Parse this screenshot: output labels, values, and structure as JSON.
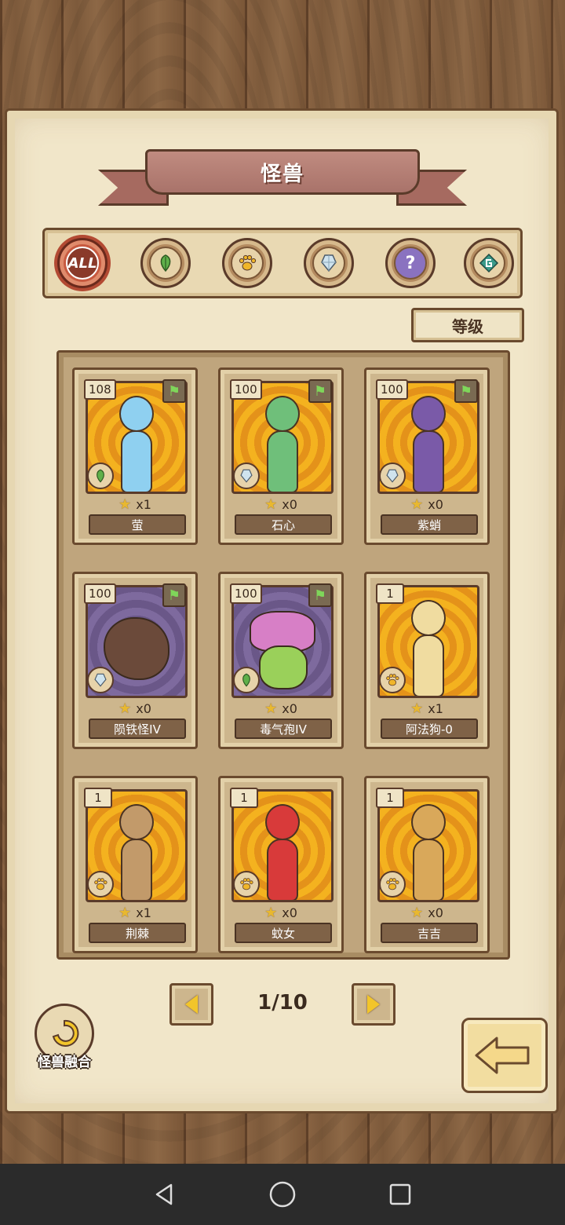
{
  "title": "怪兽",
  "filters": [
    {
      "name": "all",
      "label": "ALL",
      "icon": "all-icon",
      "active": true
    },
    {
      "name": "plant",
      "label": "",
      "icon": "leaf-icon",
      "active": false
    },
    {
      "name": "beast",
      "label": "",
      "icon": "paw-icon",
      "active": false
    },
    {
      "name": "crystal",
      "label": "",
      "icon": "crystal-icon",
      "active": false
    },
    {
      "name": "unknown",
      "label": "",
      "icon": "question-icon",
      "active": false
    },
    {
      "name": "special",
      "label": "",
      "icon": "g-rune-icon",
      "active": false
    }
  ],
  "sort_label": "等级",
  "cards": [
    {
      "level": "108",
      "count": "x1",
      "name": "萤",
      "type_icon": "leaf-icon",
      "flag": true,
      "bg": "gold",
      "color": "#8fd0f0"
    },
    {
      "level": "100",
      "count": "x0",
      "name": "石心",
      "type_icon": "crystal-icon",
      "flag": true,
      "bg": "gold",
      "color": "#6fbf7a"
    },
    {
      "level": "100",
      "count": "x0",
      "name": "紫蛸",
      "type_icon": "crystal-icon",
      "flag": true,
      "bg": "gold",
      "color": "#7a5aa8"
    },
    {
      "level": "100",
      "count": "x0",
      "name": "陨铁怪IV",
      "type_icon": "crystal-icon",
      "flag": true,
      "bg": "purple",
      "color": "#6b4a3a"
    },
    {
      "level": "100",
      "count": "x0",
      "name": "毒气孢IV",
      "type_icon": "leaf-icon",
      "flag": true,
      "bg": "purple",
      "color": "#d77fc6"
    },
    {
      "level": "1",
      "count": "x1",
      "name": "阿法狗-0",
      "type_icon": "paw-icon",
      "flag": false,
      "bg": "gold",
      "color": "#f0dca0"
    },
    {
      "level": "1",
      "count": "x1",
      "name": "荆棘",
      "type_icon": "paw-icon",
      "flag": false,
      "bg": "gold",
      "color": "#c29a6a"
    },
    {
      "level": "1",
      "count": "x0",
      "name": "蚊女",
      "type_icon": "paw-icon",
      "flag": false,
      "bg": "gold",
      "color": "#d83a3a"
    },
    {
      "level": "1",
      "count": "x0",
      "name": "吉吉",
      "type_icon": "paw-icon",
      "flag": false,
      "bg": "gold",
      "color": "#d9a85a"
    }
  ],
  "pagination": {
    "text": "1/10",
    "current": 1,
    "total": 10
  },
  "fusion_label": "怪兽融合",
  "colors": {
    "panel": "#f1e6c9",
    "frame": "#6a4a2e",
    "accent_red": "#c85a40",
    "gold": "#f2c52a"
  }
}
